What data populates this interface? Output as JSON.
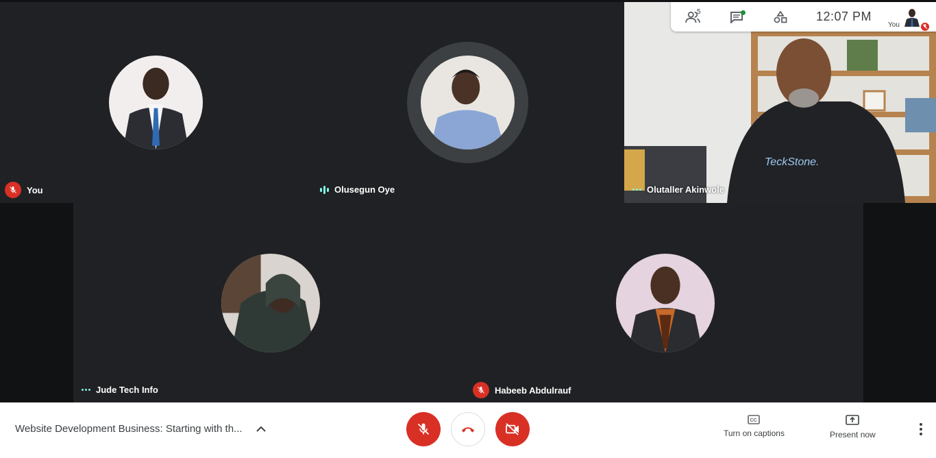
{
  "participants": [
    {
      "name": "You",
      "status": "muted"
    },
    {
      "name": "Olusegun Oye",
      "status": "speaking"
    },
    {
      "name": "Olutaller Akinwole",
      "status": "active"
    },
    {
      "name": "Jude Tech Info",
      "status": "active"
    },
    {
      "name": "Habeeb Abdulrauf",
      "status": "muted"
    }
  ],
  "topbar": {
    "people_count": "5",
    "time": "12:07  PM",
    "you_label": "You",
    "icons": [
      "people-icon",
      "chat-icon",
      "activities-icon"
    ]
  },
  "bottombar": {
    "meeting_title": "Website Development Business: Starting with th...",
    "captions_label": "Turn on captions",
    "present_label": "Present now"
  },
  "colors": {
    "tile_bg": "#202124",
    "stage_bg": "#111213",
    "danger": "#d93025",
    "speaking": "#81f7e4"
  }
}
